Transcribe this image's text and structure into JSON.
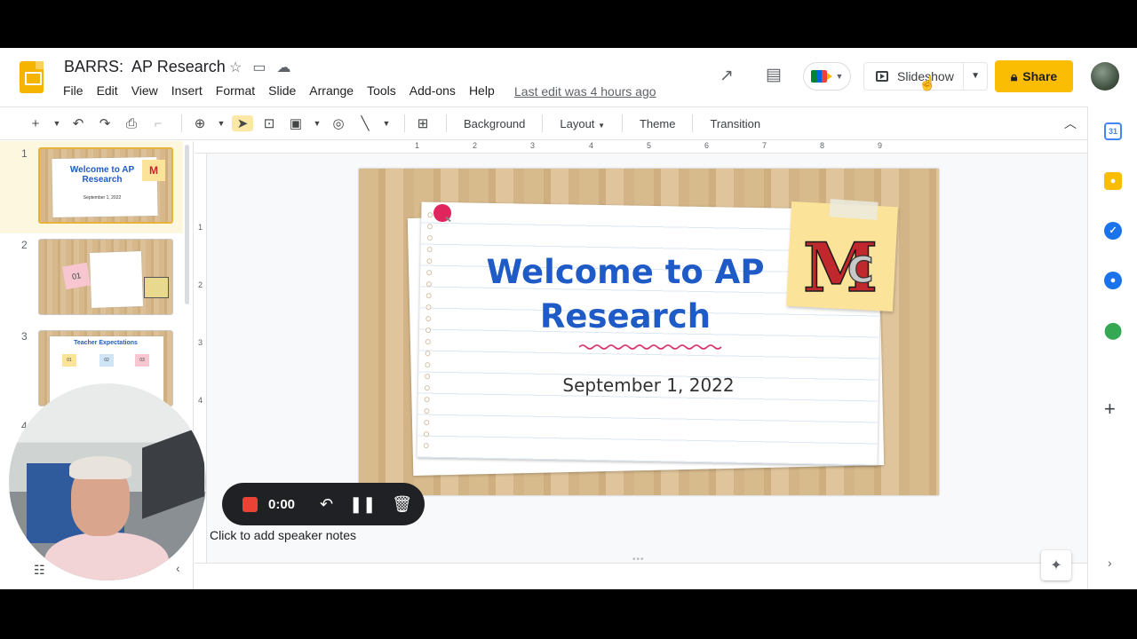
{
  "app": {
    "doc_title": "BARRS:  AP Research",
    "last_edit": "Last edit was 4 hours ago"
  },
  "menu": [
    "File",
    "Edit",
    "View",
    "Insert",
    "Format",
    "Slide",
    "Arrange",
    "Tools",
    "Add-ons",
    "Help"
  ],
  "header": {
    "slideshow_label": "Slideshow",
    "share_label": "Share"
  },
  "toolbar": {
    "background_label": "Background",
    "layout_label": "Layout",
    "theme_label": "Theme",
    "transition_label": "Transition"
  },
  "ruler": {
    "h_ticks": [
      "1",
      "2",
      "3",
      "4",
      "5",
      "6",
      "7",
      "8",
      "9"
    ],
    "v_ticks": [
      "1",
      "2",
      "3",
      "4"
    ]
  },
  "filmstrip": {
    "numbers": [
      "1",
      "2",
      "3",
      "4"
    ],
    "thumb1": {
      "title": "Welcome to AP Research",
      "date": "September 1, 2022"
    },
    "thumb2": {
      "number": "01"
    },
    "thumb3": {
      "title": "Teacher Expectations",
      "notes": [
        "01",
        "02",
        "03"
      ]
    }
  },
  "slide": {
    "title": "Welcome to AP Research",
    "date": "September 1, 2022",
    "logo_text": "MC"
  },
  "notes": {
    "placeholder": "Click to add speaker notes"
  },
  "recorder": {
    "time": "0:00"
  },
  "side_panel": {
    "calendar_label": "31"
  },
  "colors": {
    "share": "#fbbc04",
    "title_blue": "#1f5bc6",
    "rec_red": "#ea4335",
    "slides_yellow": "#f4b400"
  }
}
